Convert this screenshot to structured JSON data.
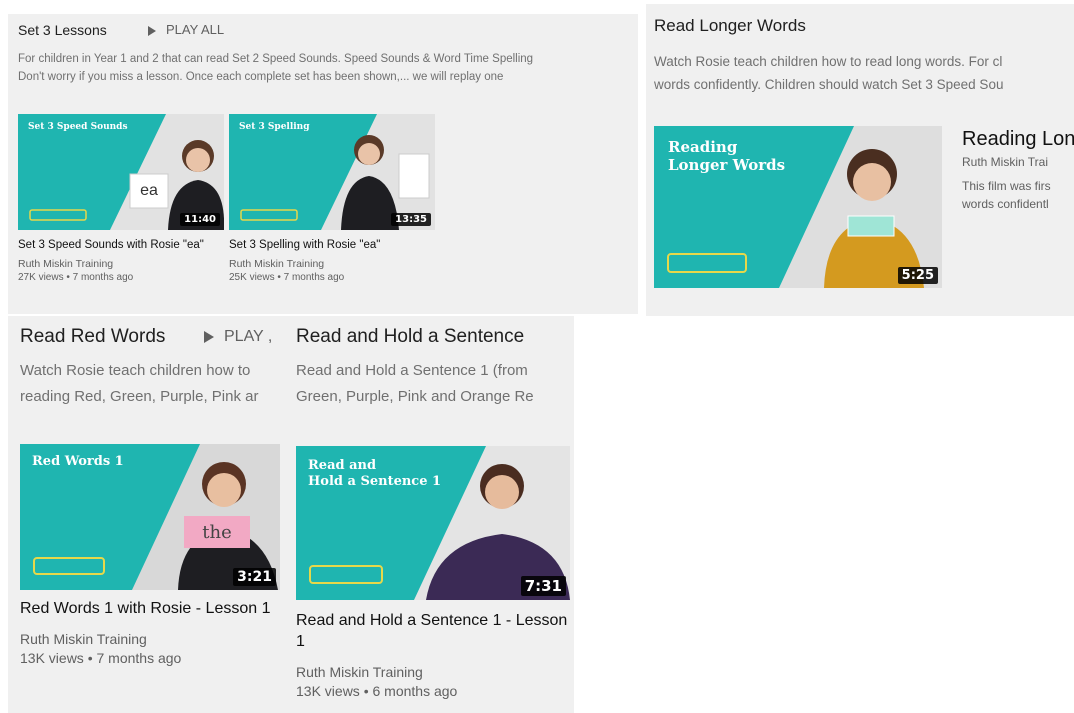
{
  "set3": {
    "title": "Set 3 Lessons",
    "play_all": "PLAY ALL",
    "description_line1": "For children in Year 1 and 2 that can read Set 2 Speed Sounds. Speed Sounds & Word Time Spelling",
    "description_line2": "Don't worry if you miss a lesson. Once each complete set has been shown,... we will replay one",
    "videos": [
      {
        "thumb_title": "Set 3 Speed Sounds",
        "card_text": "ea",
        "duration": "11:40",
        "title": "Set 3 Speed Sounds with Rosie \"ea\"",
        "channel": "Ruth Miskin Training",
        "meta": "27K views • 7 months ago"
      },
      {
        "thumb_title": "Set 3 Spelling",
        "duration": "13:35",
        "title": "Set 3 Spelling with Rosie \"ea\"",
        "channel": "Ruth Miskin Training",
        "meta": "25K views • 7 months ago"
      }
    ]
  },
  "longer": {
    "title": "Read Longer Words",
    "description_line1": "Watch Rosie teach children how to read long words. For cl",
    "description_line2": "words confidently. Children should watch Set 3 Speed Sou",
    "video": {
      "thumb_title_line1": "Reading",
      "thumb_title_line2": "Longer Words",
      "duration": "5:25",
      "title": "Reading Lon",
      "channel": "Ruth Miskin Trai",
      "desc_line1": "This film was firs",
      "desc_line2": "words confidentl"
    }
  },
  "red": {
    "title": "Read Red Words",
    "play_all": "PLAY ,",
    "description_line1": "Watch Rosie teach children how to",
    "description_line2": "reading Red, Green, Purple, Pink ar",
    "video": {
      "thumb_title": "Red Words 1",
      "card_text": "the",
      "duration": "3:21",
      "title": "Red Words 1 with Rosie - Lesson 1",
      "channel": "Ruth Miskin Training",
      "meta": "13K views • 7 months ago"
    }
  },
  "hold": {
    "title": "Read and Hold a Sentence",
    "description_line1": "Read and Hold a Sentence 1 (from",
    "description_line2": "Green, Purple, Pink and Orange Re",
    "video": {
      "thumb_title_line1": "Read and",
      "thumb_title_line2": "Hold a Sentence 1",
      "duration": "7:31",
      "title": "Read and Hold a Sentence 1 - Lesson 1",
      "channel": "Ruth Miskin Training",
      "meta": "13K views • 6 months ago"
    }
  },
  "colors": {
    "thumb_teal": "#1fb5b0",
    "thumb_grey": "#dcdcdc",
    "shirt_black": "#1e1e22",
    "shirt_mustard": "#d49a1f",
    "shirt_purple": "#3b2a55",
    "card_pink": "#f2a9c4",
    "card_mint": "#9fe5d6"
  }
}
